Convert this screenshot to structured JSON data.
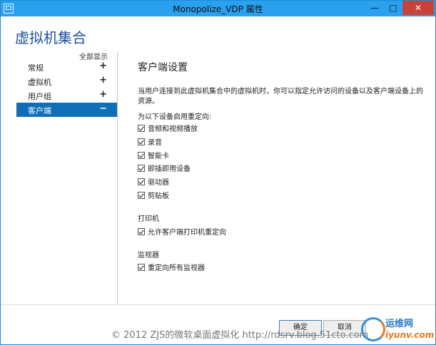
{
  "window": {
    "title": "Monopolize_VDP 属性",
    "min_symbol": "—",
    "max_symbol": "□",
    "close_symbol": "✕"
  },
  "header": {
    "title": "虚拟机集合"
  },
  "nav": {
    "show_all": "全部显示",
    "items": [
      {
        "label": "常规",
        "sign": "+"
      },
      {
        "label": "虚拟机",
        "sign": "+"
      },
      {
        "label": "用户组",
        "sign": "+"
      },
      {
        "label": "客户端",
        "sign": "−",
        "selected": true
      }
    ]
  },
  "content": {
    "section_title": "客户端设置",
    "description": "当用户连接到此虚拟机集合中的虚拟机时，你可以指定允许访问的设备以及客户端设备上的资源。",
    "redirect_label": "为以下设备启用重定向:",
    "devices": [
      {
        "label": "音频和视频播放",
        "checked": true
      },
      {
        "label": "录音",
        "checked": true
      },
      {
        "label": "智能卡",
        "checked": true
      },
      {
        "label": "即插即用设备",
        "checked": true
      },
      {
        "label": "驱动器",
        "checked": true
      },
      {
        "label": "剪贴板",
        "checked": true
      }
    ],
    "printer_heading": "打印机",
    "printer_option": {
      "label": "允许客户端打印机重定向",
      "checked": true
    },
    "monitor_heading": "监视器",
    "monitor_option": {
      "label": "重定向所有监视器",
      "checked": true
    }
  },
  "buttons": {
    "ok": "确定",
    "cancel": "取消"
  },
  "watermark": {
    "text": "© 2012 ZJS的微软桌面虚拟化 http://rdsrv.blog.51cto.com",
    "logo_cn": "运维网",
    "logo_en": "iyunv.com"
  }
}
